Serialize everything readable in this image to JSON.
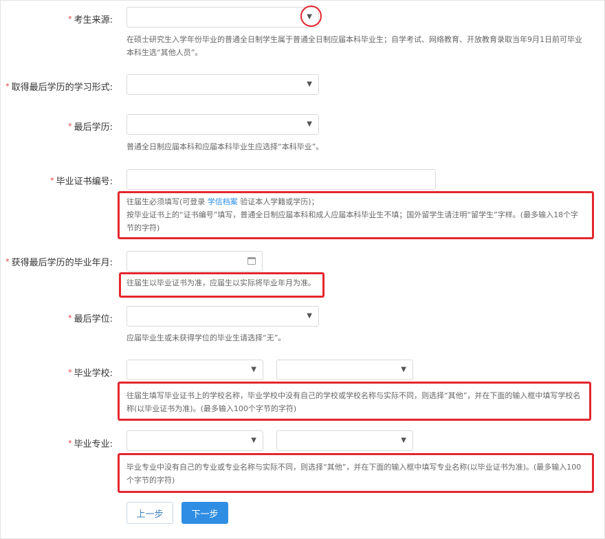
{
  "form": {
    "source": {
      "label": "考生来源:",
      "hint": "在硕士研究生入学年份毕业的普通全日制学生属于普通全日制应届本科毕业生；自学考试、网络教育、开放教育录取当年9月1日前可毕业本科生选“其他人员”。"
    },
    "study_form": {
      "label": "取得最后学历的学习形式:"
    },
    "last_degree_edu": {
      "label": "最后学历:",
      "hint": "普通全日制应届本科和应届本科毕业生应选择“本科毕业”。"
    },
    "cert_no": {
      "label": "毕业证书编号:",
      "hint_pre": "往届生必须填写(可登录 ",
      "hint_link": "学信档案",
      "hint_post": " 验证本人学籍或学历)；",
      "hint_line2": "按毕业证书上的“证书编号”填写，普通全日制应届本科和成人应届本科毕业生不填；国外留学生请注明“留学生”字样。(最多输入18个字节的字符)"
    },
    "grad_date": {
      "label": "获得最后学历的毕业年月:",
      "hint": "往届生以毕业证书为准，应届生以实际将毕业年月为准。"
    },
    "last_degree": {
      "label": "最后学位:",
      "hint": "应届毕业生或未获得学位的毕业生请选择“无”。"
    },
    "school": {
      "label": "毕业学校:",
      "hint": "往届生填写毕业证书上的学校名称，毕业学校中没有自己的学校或学校名称与实际不同，则选择“其他”，并在下面的输入框中填写学校名称(以毕业证书为准)。(最多输入100个字节的字符)"
    },
    "major": {
      "label": "毕业专业:",
      "hint": "毕业专业中没有自己的专业或专业名称与实际不同，则选择“其他”，并在下面的输入框中填写专业名称(以毕业证书为准)。(最多输入100个字节的字符)"
    }
  },
  "buttons": {
    "prev": "上一步",
    "next": "下一步"
  },
  "required_mark": "*",
  "icons": {
    "dropdown": "caret-down-icon",
    "calendar": "calendar-icon"
  },
  "colors": {
    "required": "#e4393c",
    "highlight": "#e3262e",
    "primary": "#2f8ee3",
    "link": "#2a8de4"
  }
}
